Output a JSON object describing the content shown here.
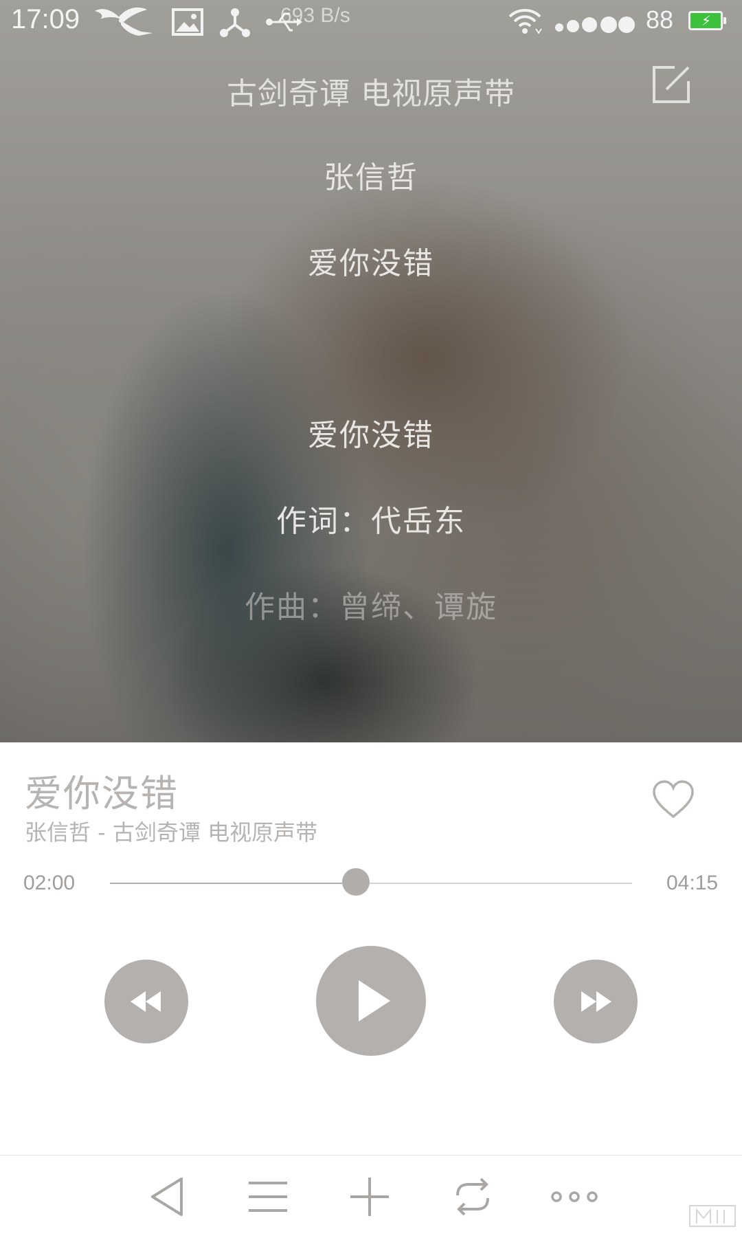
{
  "status_bar": {
    "time": "17:09",
    "net_speed": "693 B/s",
    "battery_level": "88",
    "battery_color": "#3bc13b",
    "icons": [
      "fairy-notification-icon",
      "image-icon",
      "share-hub-icon",
      "usb-icon",
      "wifi-icon",
      "signal-dots-icon",
      "battery-charging-icon"
    ]
  },
  "header": {
    "album_title": "古剑奇谭 电视原声带",
    "edit_icon": "edit-icon"
  },
  "lyrics": {
    "lines": [
      "张信哲",
      "爱你没错",
      "爱你没错",
      "作词：代岳东",
      "作曲：曾缔、谭旋"
    ]
  },
  "song": {
    "title": "爱你没错",
    "subtitle": "张信哲 - 古剑奇谭 电视原声带",
    "favorite_icon": "heart-outline-icon"
  },
  "progress": {
    "current": "02:00",
    "total": "04:15",
    "fraction": 0.471
  },
  "controls": {
    "prev_icon": "rewind-icon",
    "play_icon": "play-icon",
    "next_icon": "fast-forward-icon"
  },
  "bottom_nav": {
    "icons": [
      "back-triangle-icon",
      "playlist-menu-icon",
      "add-icon",
      "repeat-icon",
      "more-dots-icon"
    ]
  },
  "colors": {
    "control_fill": "#b3b0ad",
    "title_gray": "#b7b3b0",
    "icon_gray": "#a9a6a3"
  }
}
